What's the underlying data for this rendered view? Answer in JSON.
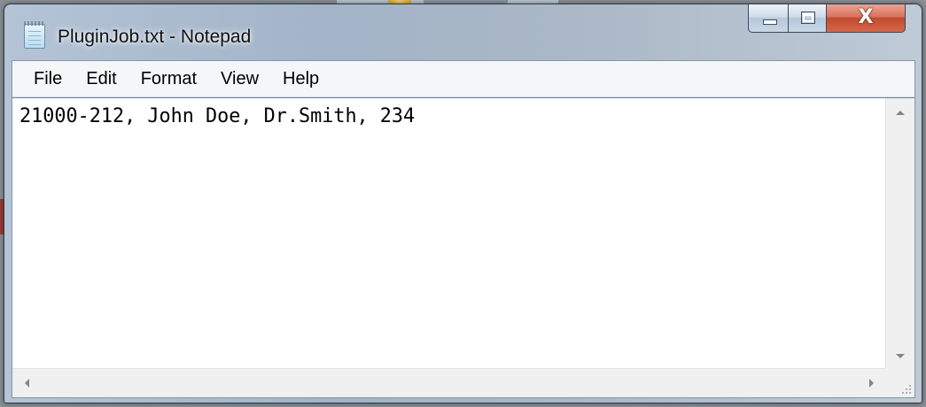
{
  "window": {
    "title": "PluginJob.txt - Notepad",
    "close_glyph": "X"
  },
  "menu": {
    "items": [
      {
        "label": "File"
      },
      {
        "label": "Edit"
      },
      {
        "label": "Format"
      },
      {
        "label": "View"
      },
      {
        "label": "Help"
      }
    ]
  },
  "editor": {
    "content": "21000-212, John Doe, Dr.Smith, 234"
  },
  "icons": {
    "app": "notepad-icon",
    "minimize": "minimize-icon",
    "maximize": "maximize-icon",
    "close": "close-icon"
  },
  "colors": {
    "close_button": "#c24a2e",
    "frame": "#a9b7c6"
  }
}
